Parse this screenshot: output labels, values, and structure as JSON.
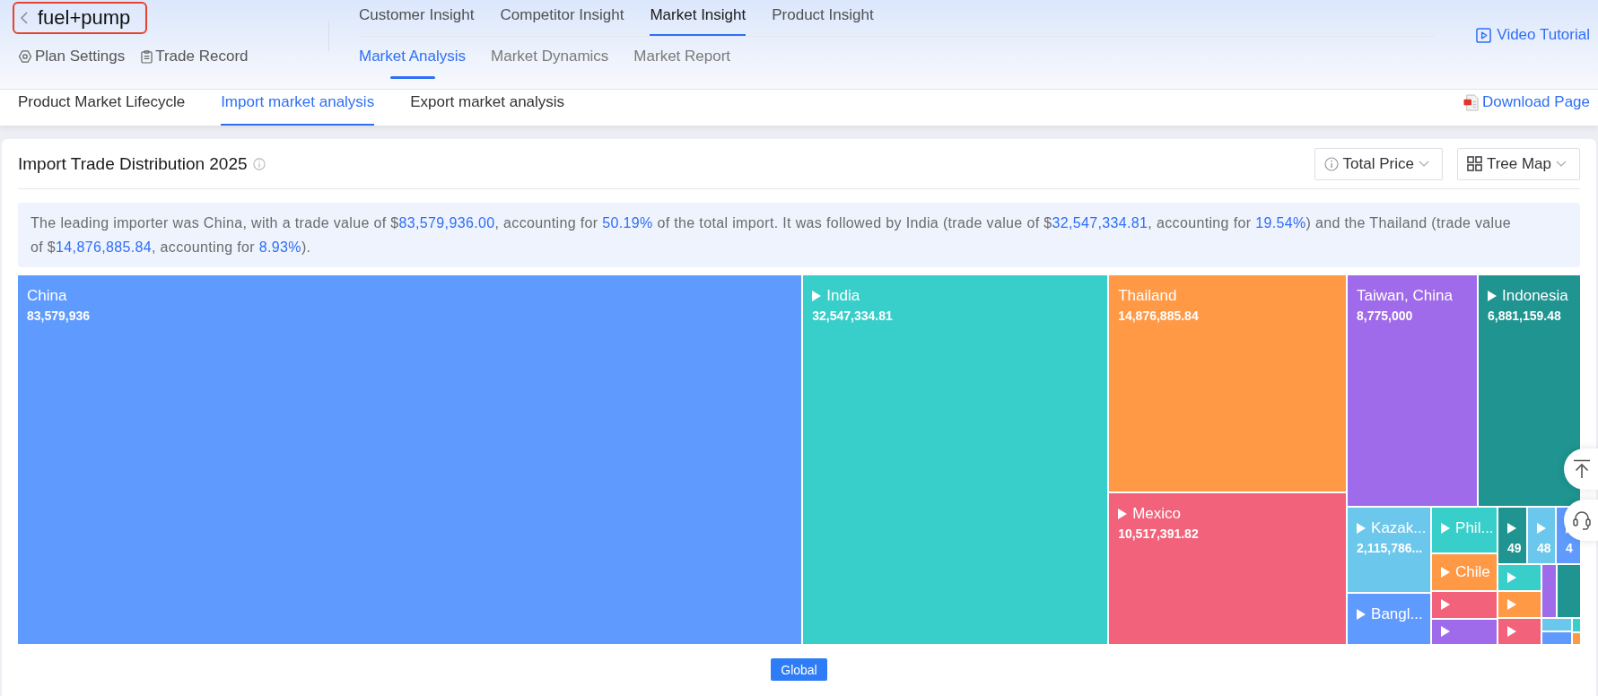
{
  "plan": {
    "name": "fuel+pump",
    "actions": [
      {
        "label": "Plan Settings",
        "kind": "settings"
      },
      {
        "label": "Trade Record",
        "kind": "record"
      }
    ]
  },
  "main_tabs": [
    {
      "label": "Customer Insight",
      "selected": false
    },
    {
      "label": "Competitor Insight",
      "selected": false
    },
    {
      "label": "Market Insight",
      "selected": true
    },
    {
      "label": "Product Insight",
      "selected": false
    }
  ],
  "sub_tabs": [
    {
      "label": "Market Analysis",
      "selected": true
    },
    {
      "label": "Market Dynamics",
      "selected": false
    },
    {
      "label": "Market Report",
      "selected": false
    }
  ],
  "video_tutorial": "Video Tutorial",
  "page_tabs": [
    {
      "label": "Product Market Lifecycle",
      "selected": false
    },
    {
      "label": "Import market analysis",
      "selected": true
    },
    {
      "label": "Export market analysis",
      "selected": false
    }
  ],
  "download_page": "Download Page",
  "card": {
    "title": "Import Trade Distribution 2025",
    "controls": [
      {
        "label": "Total Price",
        "kind": "info"
      },
      {
        "label": "Tree Map",
        "kind": "grid"
      }
    ],
    "summary": [
      {
        "text": "The leading importer was China, with a trade value of $",
        "highlight": false
      },
      {
        "text": "83,579,936.00",
        "highlight": true
      },
      {
        "text": ", accounting for ",
        "highlight": false
      },
      {
        "text": "50.19%",
        "highlight": true
      },
      {
        "text": " of the total import. It was followed by India (trade value of $",
        "highlight": false
      },
      {
        "text": "32,547,334.81",
        "highlight": true
      },
      {
        "text": ", accounting for ",
        "highlight": false
      },
      {
        "text": "19.54%",
        "highlight": true
      },
      {
        "text": ") and the Thailand (trade value of $",
        "highlight": false
      },
      {
        "text": "14,876,885.84",
        "highlight": true
      },
      {
        "text": ", accounting for ",
        "highlight": false
      },
      {
        "text": "8.93%",
        "highlight": true
      },
      {
        "text": ").",
        "highlight": false
      }
    ],
    "treemap": {
      "tiles": [
        {
          "label": "China",
          "value": "83,579,936",
          "drill_down": false,
          "color": "#5f9bff"
        },
        {
          "label": "India",
          "value": "32,547,334.81",
          "drill_down": true,
          "color": "#38cfca"
        },
        {
          "label": "Thailand",
          "value": "14,876,885.84",
          "drill_down": false,
          "color": "#ff9946"
        },
        {
          "label": "Mexico",
          "value": "10,517,391.82",
          "drill_down": true,
          "color": "#f2637b"
        },
        {
          "label": "Taiwan, China",
          "value": "8,775,000",
          "drill_down": false,
          "color": "#a06bea"
        },
        {
          "label": "Indonesia",
          "value": "6,881,159.48",
          "drill_down": true,
          "color": "#1f9490"
        },
        {
          "label": "Kazak...",
          "value": "2,115,786...",
          "drill_down": true,
          "color": "#6bc7ec"
        },
        {
          "label": "Bangl...",
          "drill_down": true,
          "color": "#5f9bff"
        },
        {
          "label": "Phil...",
          "drill_down": true,
          "color": "#38cfca"
        },
        {
          "label": "Chile",
          "drill_down": true,
          "color": "#ff9946"
        },
        {
          "drill_down": true,
          "color": "#f2637b"
        },
        {
          "drill_down": true,
          "color": "#a06bea"
        },
        {
          "value": "49",
          "drill_down": true,
          "color": "#1f9490"
        },
        {
          "value": "48",
          "drill_down": true,
          "color": "#6bc7ec"
        },
        {
          "value": "4",
          "drill_down": true,
          "color": "#5f9bff"
        },
        {
          "drill_down": true,
          "color": "#38cfca"
        },
        {
          "drill_down": true,
          "color": "#ff9946"
        },
        {
          "drill_down": true,
          "color": "#f2637b"
        },
        {
          "drill_down": false,
          "color": "#a06bea"
        },
        {
          "drill_down": false,
          "color": "#1f9490"
        },
        {
          "drill_down": false,
          "color": "#6bc7ec"
        },
        {
          "drill_down": false,
          "color": "#5f9bff"
        },
        {
          "drill_down": false,
          "color": "#38cfca"
        },
        {
          "drill_down": false,
          "color": "#ff9946"
        }
      ]
    },
    "breadcrumb": "Global"
  }
}
